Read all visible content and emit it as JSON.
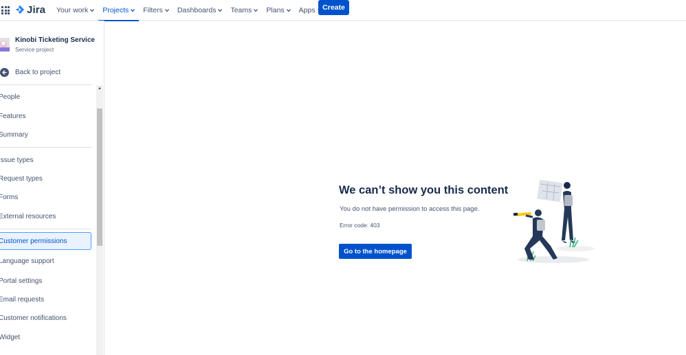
{
  "nav": {
    "logo_text": "Jira",
    "items": [
      {
        "label": "Your work",
        "active": false
      },
      {
        "label": "Projects",
        "active": true
      },
      {
        "label": "Filters",
        "active": false
      },
      {
        "label": "Dashboards",
        "active": false
      },
      {
        "label": "Teams",
        "active": false
      },
      {
        "label": "Plans",
        "active": false
      },
      {
        "label": "Apps",
        "active": false
      }
    ],
    "create_label": "Create"
  },
  "sidebar": {
    "project_name": "Kinobi Ticketing Service",
    "project_type": "Service project",
    "back_label": "Back to project",
    "items": [
      {
        "label": "People"
      },
      {
        "label": "Features"
      },
      {
        "label": "Summary"
      },
      {
        "label": "Issue types"
      },
      {
        "label": "Request types"
      },
      {
        "label": "Forms"
      },
      {
        "label": "External resources"
      },
      {
        "label": "Customer permissions",
        "selected": true
      },
      {
        "label": "Language support"
      },
      {
        "label": "Portal settings"
      },
      {
        "label": "Email requests"
      },
      {
        "label": "Customer notifications"
      },
      {
        "label": "Widget"
      }
    ]
  },
  "error": {
    "title": "We can’t show you this content",
    "description": "You do not have permission to access this page.",
    "code": "Error code: 403",
    "button_label": "Go to the homepage"
  },
  "colors": {
    "brand": "#0052cc",
    "text": "#172b4d",
    "subtle": "#42526e",
    "selected_bg": "#e9f2ff",
    "selected_border": "#4c9aff"
  }
}
